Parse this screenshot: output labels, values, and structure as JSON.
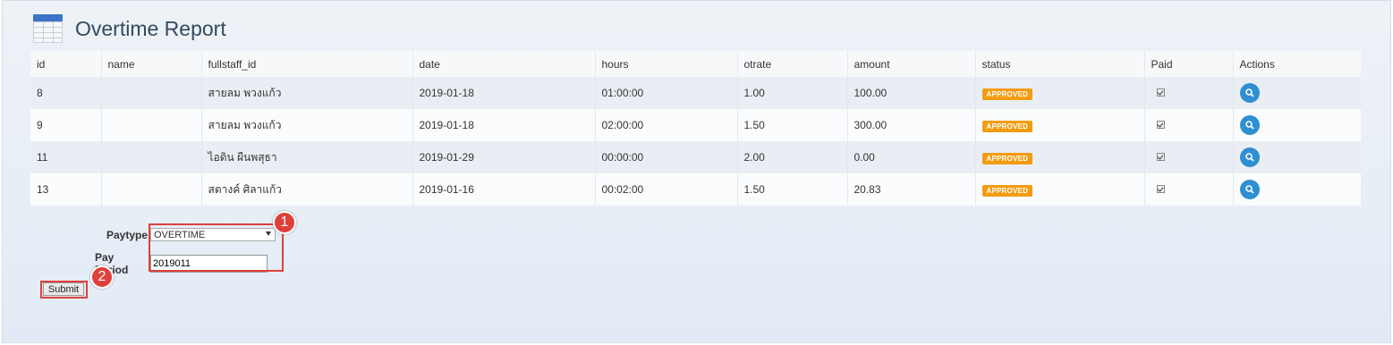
{
  "header": {
    "title": "Overtime Report",
    "icon": "table-icon"
  },
  "table": {
    "columns": [
      "id",
      "name",
      "fullstaff_id",
      "date",
      "hours",
      "otrate",
      "amount",
      "status",
      "Paid",
      "Actions"
    ],
    "rows": [
      {
        "id": "8",
        "name": "",
        "fullstaff_id": "สายลม พวงแก้ว",
        "date": "2019-01-18",
        "hours": "01:00:00",
        "otrate": "1.00",
        "amount": "100.00",
        "status": "APPROVED",
        "paid": true
      },
      {
        "id": "9",
        "name": "",
        "fullstaff_id": "สายลม พวงแก้ว",
        "date": "2019-01-18",
        "hours": "02:00:00",
        "otrate": "1.50",
        "amount": "300.00",
        "status": "APPROVED",
        "paid": true
      },
      {
        "id": "11",
        "name": "",
        "fullstaff_id": "ไอดิน ผืนพสุธา",
        "date": "2019-01-29",
        "hours": "00:00:00",
        "otrate": "2.00",
        "amount": "0.00",
        "status": "APPROVED",
        "paid": true
      },
      {
        "id": "13",
        "name": "",
        "fullstaff_id": "สตางค์ ศิลาแก้ว",
        "date": "2019-01-16",
        "hours": "00:02:00",
        "otrate": "1.50",
        "amount": "20.83",
        "status": "APPROVED",
        "paid": true
      }
    ],
    "status_color": "#f39c12",
    "action_icon": "search-icon"
  },
  "form": {
    "paytype_label": "Paytype",
    "paytype_value": "OVERTIME",
    "period_label": "Pay Period",
    "period_value": "2019011",
    "submit_label": "Submit"
  },
  "annotations": {
    "callout_1": "1",
    "callout_2": "2",
    "color": "#e0403a"
  }
}
